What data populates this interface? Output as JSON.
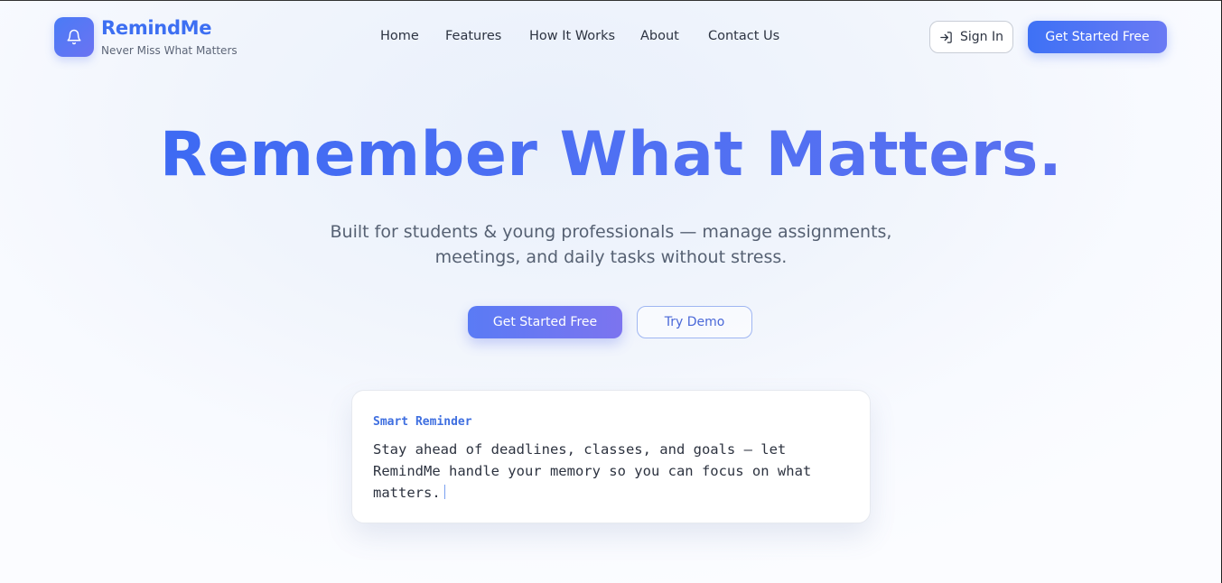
{
  "brand": {
    "name": "RemindMe",
    "tagline": "Never Miss What Matters",
    "logo_icon": "bell-icon"
  },
  "nav": {
    "items": [
      {
        "label": "Home"
      },
      {
        "label": "Features"
      },
      {
        "label": "How It Works"
      },
      {
        "label": "About"
      },
      {
        "label": "Contact Us"
      }
    ]
  },
  "header_actions": {
    "signin_label": "Sign In",
    "signin_icon": "login-icon",
    "cta_label": "Get Started Free"
  },
  "hero": {
    "title": "Remember What Matters.",
    "subtitle_line1": "Built for students & young professionals — manage assignments,",
    "subtitle_line2": "meetings, and daily tasks without stress.",
    "primary_cta": "Get Started Free",
    "secondary_cta": "Try Demo"
  },
  "card": {
    "label": "Smart Reminder",
    "line1": "Stay ahead of deadlines, classes, and goals — let",
    "line2": "RemindMe handle your memory so you can focus on what",
    "line3": "matters."
  },
  "colors": {
    "accent": "#3d6ff2",
    "accent_purple": "#7c74ef",
    "text": "#2d3442",
    "muted": "#566173"
  }
}
